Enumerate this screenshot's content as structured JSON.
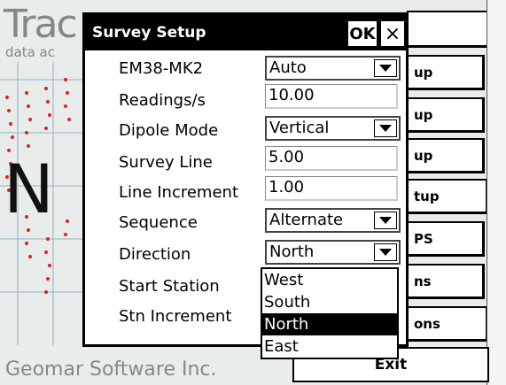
{
  "app": {
    "logo_text": "Trac",
    "logo_subtext": "data ac",
    "footer": "Geomar Software Inc.",
    "side_buttons": [
      "up",
      "up",
      "up",
      "tup",
      "PS",
      "ns",
      "ons"
    ],
    "exit_label": "Exit"
  },
  "dialog": {
    "title": "Survey Setup",
    "ok_label": "OK",
    "close_label": "×",
    "fields": [
      {
        "label": "EM38-MK2",
        "value": "Auto",
        "kind": "combo"
      },
      {
        "label": "Readings/s",
        "value": "10.00",
        "kind": "text"
      },
      {
        "label": "Dipole Mode",
        "value": "Vertical",
        "kind": "combo"
      },
      {
        "label": "Survey Line",
        "value": "5.00",
        "kind": "text"
      },
      {
        "label": "Line Increment",
        "value": "1.00",
        "kind": "text"
      },
      {
        "label": "Sequence",
        "value": "Alternate",
        "kind": "combo"
      },
      {
        "label": "Direction",
        "value": "North",
        "kind": "combo"
      },
      {
        "label": "Start Station",
        "value": "",
        "kind": "hidden"
      },
      {
        "label": "Stn Increment",
        "value": "",
        "kind": "hidden"
      }
    ]
  },
  "dropdown": {
    "options": [
      "West",
      "South",
      "North",
      "East"
    ],
    "selected": "North"
  }
}
